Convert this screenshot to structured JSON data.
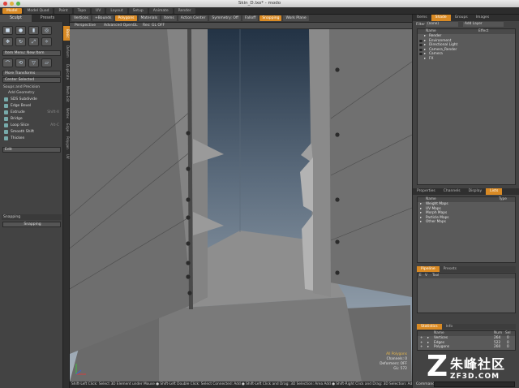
{
  "window": {
    "title": "Skin_D.lxo* - modo"
  },
  "main_tabs": [
    "Model",
    "Model Quad",
    "Paint",
    "Topo",
    "UV",
    "Layout",
    "Setup",
    "Animate",
    "Render"
  ],
  "left_panel": {
    "subtabs": [
      "Sculpt",
      "Presets"
    ],
    "item_menu": "Item Menu: New Item",
    "more_transforms": "More Transforms",
    "center_selected": "Center Selected",
    "section_title": "Soups and Precision",
    "section_sub": "Add Geometry",
    "tools": [
      {
        "label": "SDS Subdivide",
        "shortcut": ""
      },
      {
        "label": "Edge Bevel",
        "shortcut": ""
      },
      {
        "label": "Extrude",
        "shortcut": "Shift-X"
      },
      {
        "label": "Bridge",
        "shortcut": ""
      },
      {
        "label": "Loop Slice",
        "shortcut": "Alt-C"
      },
      {
        "label": "Smooth Shift",
        "shortcut": ""
      },
      {
        "label": "Thicken",
        "shortcut": ""
      }
    ],
    "edit_bar": "Edit",
    "snapping_title": "Snapping",
    "snapping_btn": "Snapping"
  },
  "vertical_tabs": [
    "Basic",
    "Deform",
    "Duplicate",
    "Mesh Edit",
    "Vertex",
    "Edge",
    "Polygon",
    "UV"
  ],
  "toolbar": {
    "vertices": "Vertices",
    "boundary": "+Bounds",
    "polygons": "Polygons",
    "materials": "Materials",
    "items": "Items",
    "action_center": "Action Center",
    "symmetry": "Symmetry: Off",
    "falloff": "Falloff",
    "snapping": "Snapping",
    "work_plane": "Work Plane"
  },
  "viewport_bar": {
    "view": "Perspective",
    "style": "Advanced OpenGL",
    "res": "Res: GL OFF"
  },
  "hud": {
    "line1": "All Polygons",
    "line2": "Channels: 0",
    "line3": "Deformers: OFF",
    "line4": "GL: 572"
  },
  "status_text": "Shift-Left Click: Select 3D Element under Mouse ● Shift-Left Double Click: Select Connected: Add ● Shift-Left Click and Drag: 3D Selection: Area Add ● Shift-Right Click and Drag: 3D Selection: Add ● Shift-Middle",
  "right_panel": {
    "top_tabs": [
      "Items",
      "Shade",
      "Groups",
      "Images"
    ],
    "filter_label": "Filter",
    "filter_value": "(none)",
    "add_layer": "Add Layer",
    "shader_header": [
      "Name",
      "Effect"
    ],
    "shader_items": [
      "Render",
      "Environment",
      "Directional Light",
      "Camera_Render",
      "Camera",
      "FX"
    ],
    "mid_tabs": [
      "Properties",
      "Channels",
      "Display",
      "Lists"
    ],
    "lists_header": [
      "Name",
      "Type"
    ],
    "lists_items": [
      "Weight Maps",
      "UV Maps",
      "Morph Maps",
      "Particle Maps",
      "Other Maps"
    ],
    "pipeline_tabs": [
      "Pipeline",
      "Presets"
    ],
    "pipeline_header": [
      "E",
      "V",
      "Tool"
    ],
    "stats_tabs": [
      "Statistics",
      "Info"
    ],
    "stats_header": [
      "Name",
      "Num",
      "Sel"
    ],
    "stats_rows": [
      {
        "name": "Vertices",
        "num": "264",
        "sel": "0"
      },
      {
        "name": "Edges",
        "num": "522",
        "sel": "0"
      },
      {
        "name": "Polygons",
        "num": "260",
        "sel": "0"
      }
    ],
    "command_label": "Command"
  },
  "watermark": {
    "glyph": "Z",
    "text": "朱峰社区",
    "url": "ZF3D.COM"
  },
  "colors": {
    "accent": "#d98a24",
    "panel": "#434343"
  }
}
